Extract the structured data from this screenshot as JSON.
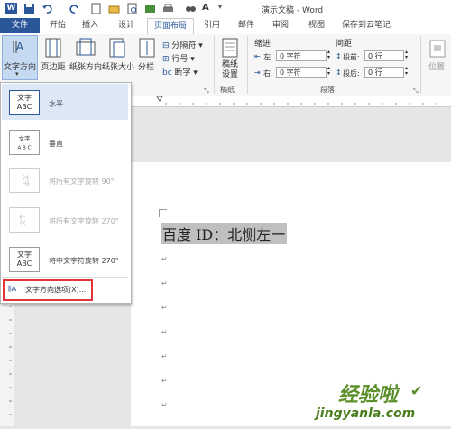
{
  "window": {
    "title": "演示文稿 - Word"
  },
  "quick_access": [
    "word-logo-icon",
    "save-icon",
    "undo-icon",
    "redo-icon",
    "new-icon",
    "open-icon",
    "print-preview-icon",
    "format-painter-icon",
    "find-icon",
    "font-color-icon",
    "customize-icon"
  ],
  "tabs": {
    "file": "文件",
    "home": "开始",
    "insert": "插入",
    "design": "设计",
    "layout": "页面布局",
    "references": "引用",
    "mailings": "邮件",
    "review": "审阅",
    "view": "视图",
    "cloud": "保存到云笔记"
  },
  "ribbon": {
    "text_direction": "文字方向",
    "margins": "页边距",
    "orientation": "纸张方向",
    "size": "纸张大小",
    "columns": "分栏",
    "breaks": "分隔符",
    "line_numbers": "行号",
    "hyphenation": "断字",
    "manuscript_line1": "稿纸",
    "manuscript_line2": "设置",
    "manuscript_group": "稿纸",
    "indent": "缩进",
    "spacing": "间距",
    "indent_left_label": "左:",
    "indent_left_value": "0 字符",
    "indent_right_label": "右:",
    "indent_right_value": "0 字符",
    "space_before_label": "段前:",
    "space_before_value": "0 行",
    "space_after_label": "段后:",
    "space_after_value": "0 行",
    "paragraph_group": "段落",
    "position": "位置"
  },
  "menu": {
    "items": [
      {
        "label": "水平",
        "icon_text": "文字\nABC",
        "disabled": false
      },
      {
        "label": "垂直",
        "icon_text": "",
        "disabled": false
      },
      {
        "label": "将所有文字旋转 90°",
        "icon_text": "",
        "disabled": true
      },
      {
        "label": "将所有文字旋转 270°",
        "icon_text": "",
        "disabled": true
      },
      {
        "label": "将中文字符旋转 270°",
        "icon_text": "",
        "disabled": false
      }
    ],
    "options": "文字方向选项(X)..."
  },
  "document": {
    "line1": "百度 ID：北恻左一"
  },
  "watermark": {
    "brand": "经验啦",
    "url": "jingyanla.com"
  },
  "colors": {
    "accent": "#2b579a",
    "highlight": "#e1353a"
  }
}
